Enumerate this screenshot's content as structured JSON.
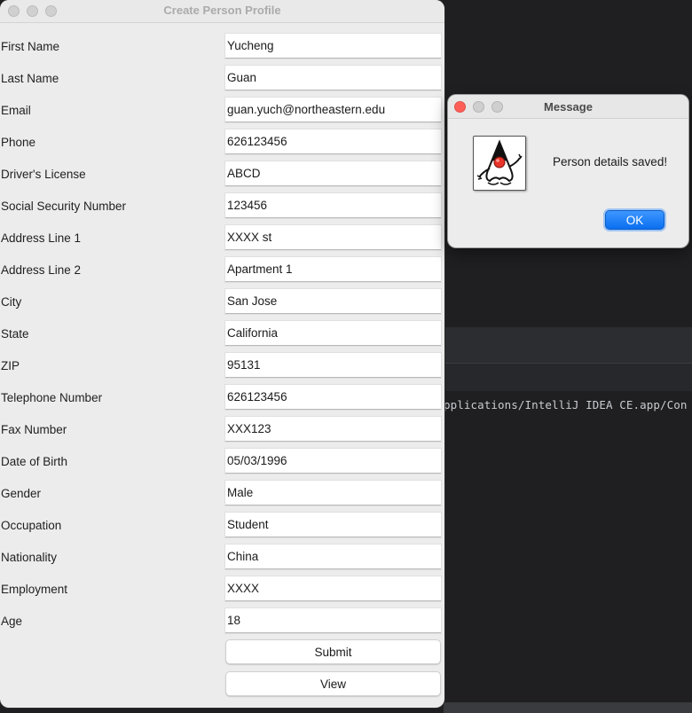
{
  "window": {
    "title": "Create Person Profile"
  },
  "form": {
    "fields": [
      {
        "label": "First Name",
        "value": "Yucheng"
      },
      {
        "label": "Last Name",
        "value": "Guan"
      },
      {
        "label": "Email",
        "value": "guan.yuch@northeastern.edu"
      },
      {
        "label": "Phone",
        "value": "626123456"
      },
      {
        "label": "Driver's License",
        "value": "ABCD"
      },
      {
        "label": "Social Security Number",
        "value": "123456"
      },
      {
        "label": "Address Line 1",
        "value": "XXXX st"
      },
      {
        "label": "Address Line 2",
        "value": "Apartment 1"
      },
      {
        "label": "City",
        "value": "San Jose"
      },
      {
        "label": "State",
        "value": "California"
      },
      {
        "label": "ZIP",
        "value": "95131"
      },
      {
        "label": "Telephone Number",
        "value": "626123456"
      },
      {
        "label": "Fax Number",
        "value": "XXX123"
      },
      {
        "label": "Date of Birth",
        "value": "05/03/1996"
      },
      {
        "label": "Gender",
        "value": "Male"
      },
      {
        "label": "Occupation",
        "value": "Student"
      },
      {
        "label": "Nationality",
        "value": "China"
      },
      {
        "label": "Employment",
        "value": "XXXX"
      },
      {
        "label": "Age",
        "value": "18"
      }
    ],
    "submit_label": "Submit",
    "view_label": "View"
  },
  "dialog": {
    "title": "Message",
    "message": "Person details saved!",
    "ok_label": "OK",
    "icon": "java-duke-icon"
  },
  "ide": {
    "console_text": "pplications/IntelliJ IDEA CE.app/Con"
  },
  "colors": {
    "ok_button": "#0a7bfd",
    "close_dot": "#ff5f57",
    "ide_background": "#1f1f21"
  }
}
